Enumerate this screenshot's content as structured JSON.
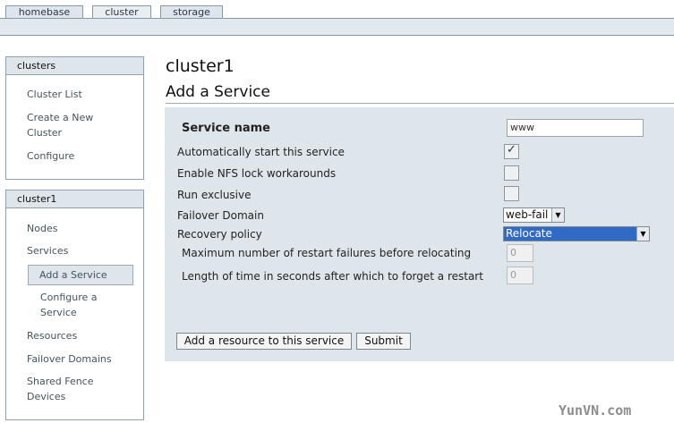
{
  "tabs": [
    {
      "label": "homebase"
    },
    {
      "label": "cluster"
    },
    {
      "label": "storage"
    }
  ],
  "sidebar": {
    "clusters_box": {
      "title": "clusters",
      "items": [
        {
          "label": "Cluster List"
        },
        {
          "label": "Create a New Cluster"
        },
        {
          "label": "Configure"
        }
      ]
    },
    "cluster1_box": {
      "title": "cluster1",
      "items": [
        {
          "label": "Nodes"
        },
        {
          "label": "Services"
        },
        {
          "label": "Add a Service"
        },
        {
          "label": "Configure a Service"
        },
        {
          "label": "Resources"
        },
        {
          "label": "Failover Domains"
        },
        {
          "label": "Shared Fence Devices"
        }
      ]
    }
  },
  "main": {
    "cluster_title": "cluster1",
    "page_title": "Add a Service",
    "form": {
      "service_name_label": "Service name",
      "service_name_value": "www",
      "autostart_label": "Automatically start this service",
      "autostart_checked": true,
      "nfs_lock_label": "Enable NFS lock workarounds",
      "nfs_lock_checked": false,
      "run_exclusive_label": "Run exclusive",
      "run_exclusive_checked": false,
      "failover_domain_label": "Failover Domain",
      "failover_domain_value": "web-fail",
      "recovery_policy_label": "Recovery policy",
      "recovery_policy_value": "Relocate",
      "max_restart_label": "Maximum number of restart failures before relocating",
      "max_restart_value": "0",
      "forget_restart_label": "Length of time in seconds after which to forget a restart",
      "forget_restart_value": "0",
      "add_resource_button": "Add a resource to this service",
      "submit_button": "Submit"
    }
  },
  "watermark": "YunVN.com"
}
